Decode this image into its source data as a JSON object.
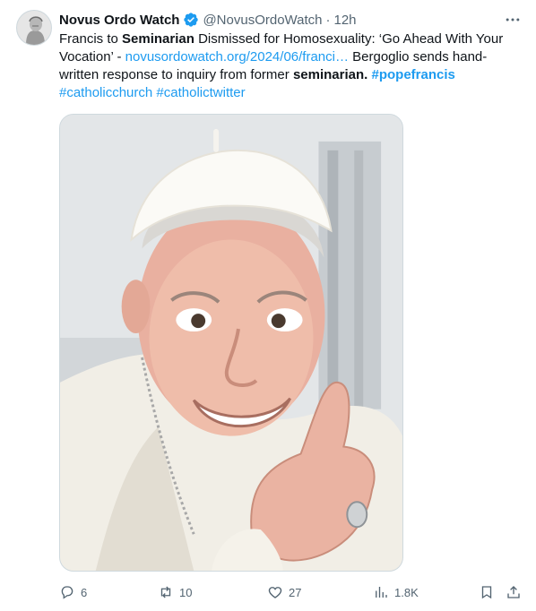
{
  "author": {
    "display_name": "Novus Ordo Watch",
    "handle": "@NovusOrdoWatch",
    "separator": "·",
    "time": "12h"
  },
  "tweet_text": {
    "t1": "Francis to ",
    "t2": "Seminarian",
    "t3": " Dismissed for Homosexuality: ‘Go Ahead With Your Vocation’ - ",
    "link": "novusordowatch.org/2024/06/franci…",
    "t4": " Bergoglio sends hand-written response to inquiry from former ",
    "t5": "seminarian",
    "t6": ". ",
    "hashtag1": "#popefrancis",
    "hashtag2": "#catholicchurch",
    "hashtag3": "#catholictwitter"
  },
  "metrics": {
    "replies": "6",
    "reposts": "10",
    "likes": "27",
    "views": "1.8K"
  },
  "icons": {
    "verified": "verified-badge-icon",
    "more": "more-icon",
    "reply": "reply-icon",
    "repost": "repost-icon",
    "like": "heart-icon",
    "views": "views-icon",
    "bookmark": "bookmark-icon",
    "share": "share-icon"
  },
  "colors": {
    "link": "#1d9bf0",
    "muted": "#536471",
    "text": "#0f1419"
  }
}
